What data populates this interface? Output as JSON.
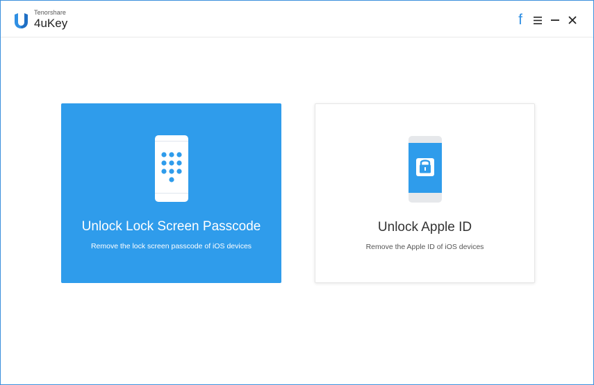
{
  "app": {
    "vendor": "Tenorshare",
    "name": "4uKey"
  },
  "window_controls": {
    "facebook_label": "f"
  },
  "options": [
    {
      "title": "Unlock Lock Screen Passcode",
      "description": "Remove the lock screen passcode of iOS devices",
      "icon": "phone-keypad-icon"
    },
    {
      "title": "Unlock Apple ID",
      "description": "Remove the Apple ID of iOS devices",
      "icon": "phone-lock-icon"
    }
  ],
  "colors": {
    "accent": "#2f9ceb",
    "window_border": "#3a8fdc",
    "title_text": "#333333"
  }
}
